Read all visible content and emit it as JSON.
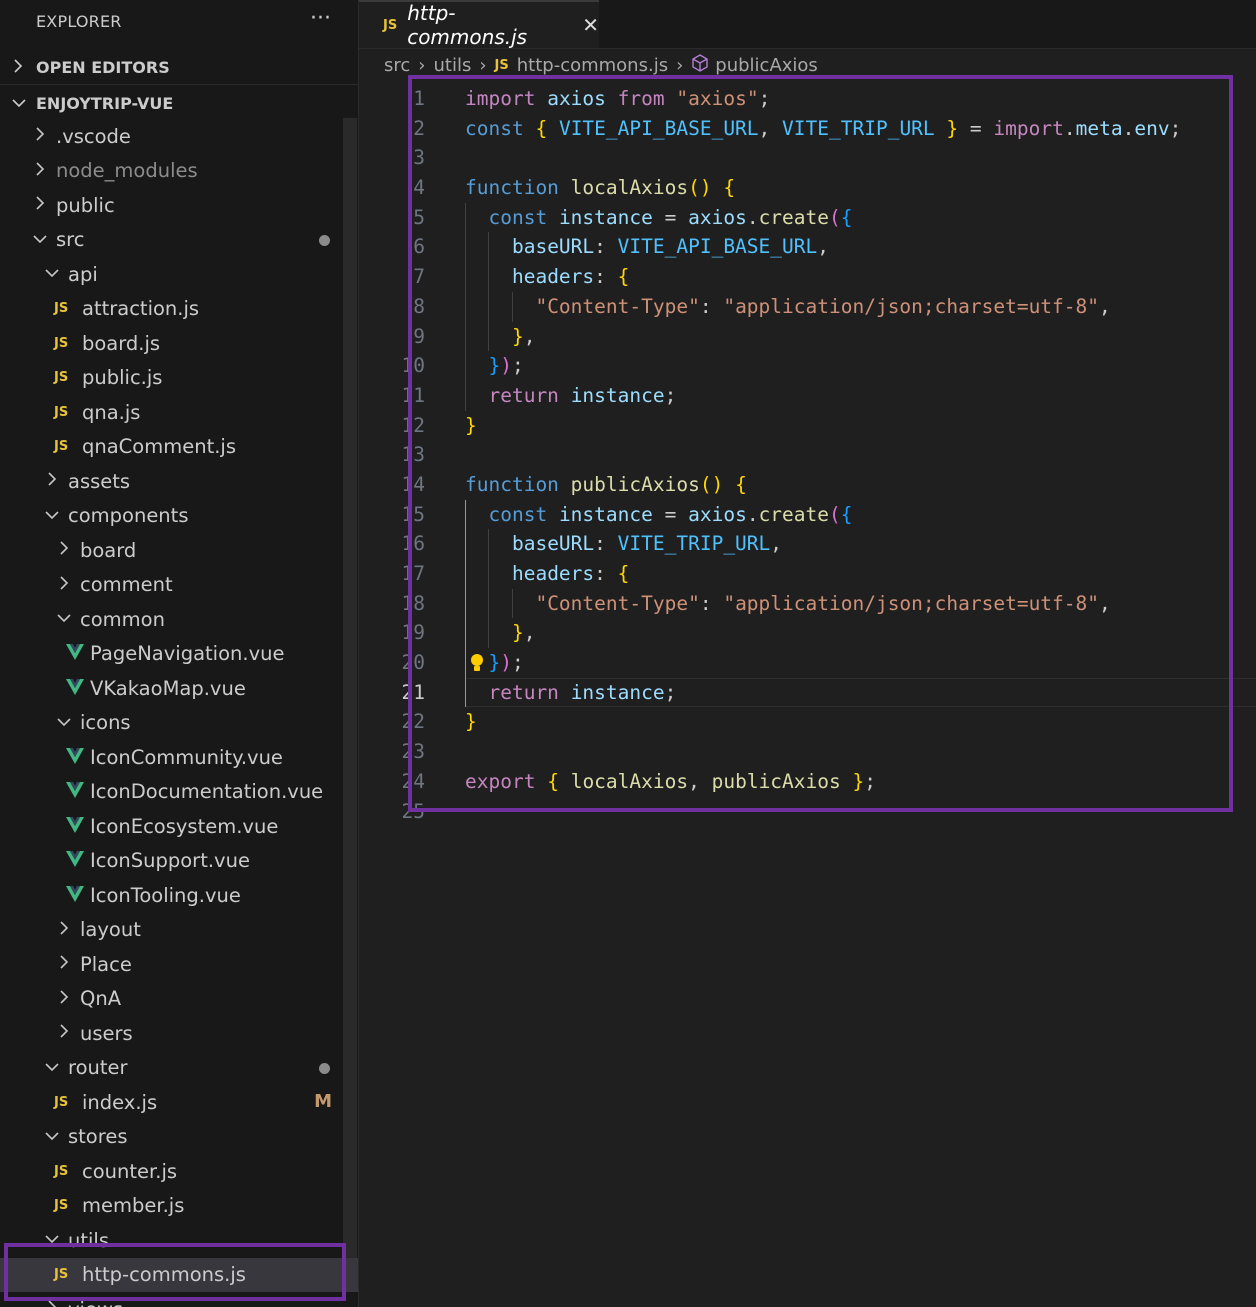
{
  "explorer": {
    "title": "EXPLORER",
    "more": "···",
    "open_editors": "OPEN EDITORS",
    "project": "ENJOYTRIP-VUE"
  },
  "tree": [
    {
      "label": ".vscode",
      "kind": "folder-closed",
      "depth": 0
    },
    {
      "label": "node_modules",
      "kind": "folder-closed",
      "depth": 0,
      "dim": true
    },
    {
      "label": "public",
      "kind": "folder-closed",
      "depth": 0
    },
    {
      "label": "src",
      "kind": "folder-open",
      "depth": 0,
      "dot": true
    },
    {
      "label": "api",
      "kind": "folder-open",
      "depth": 1
    },
    {
      "label": "attraction.js",
      "kind": "js",
      "depth": 2
    },
    {
      "label": "board.js",
      "kind": "js",
      "depth": 2
    },
    {
      "label": "public.js",
      "kind": "js",
      "depth": 2
    },
    {
      "label": "qna.js",
      "kind": "js",
      "depth": 2
    },
    {
      "label": "qnaComment.js",
      "kind": "js",
      "depth": 2
    },
    {
      "label": "assets",
      "kind": "folder-closed",
      "depth": 1
    },
    {
      "label": "components",
      "kind": "folder-open",
      "depth": 1
    },
    {
      "label": "board",
      "kind": "folder-closed",
      "depth": 2
    },
    {
      "label": "comment",
      "kind": "folder-closed",
      "depth": 2
    },
    {
      "label": "common",
      "kind": "folder-open",
      "depth": 2
    },
    {
      "label": "PageNavigation.vue",
      "kind": "vue",
      "depth": 3
    },
    {
      "label": "VKakaoMap.vue",
      "kind": "vue",
      "depth": 3
    },
    {
      "label": "icons",
      "kind": "folder-open",
      "depth": 2
    },
    {
      "label": "IconCommunity.vue",
      "kind": "vue",
      "depth": 3
    },
    {
      "label": "IconDocumentation.vue",
      "kind": "vue",
      "depth": 3
    },
    {
      "label": "IconEcosystem.vue",
      "kind": "vue",
      "depth": 3
    },
    {
      "label": "IconSupport.vue",
      "kind": "vue",
      "depth": 3
    },
    {
      "label": "IconTooling.vue",
      "kind": "vue",
      "depth": 3
    },
    {
      "label": "layout",
      "kind": "folder-closed",
      "depth": 2
    },
    {
      "label": "Place",
      "kind": "folder-closed",
      "depth": 2
    },
    {
      "label": "QnA",
      "kind": "folder-closed",
      "depth": 2
    },
    {
      "label": "users",
      "kind": "folder-closed",
      "depth": 2
    },
    {
      "label": "router",
      "kind": "folder-open",
      "depth": 1,
      "dot": true
    },
    {
      "label": "index.js",
      "kind": "js",
      "depth": 2,
      "badge": "M"
    },
    {
      "label": "stores",
      "kind": "folder-open",
      "depth": 1
    },
    {
      "label": "counter.js",
      "kind": "js",
      "depth": 2
    },
    {
      "label": "member.js",
      "kind": "js",
      "depth": 2
    },
    {
      "label": "utils",
      "kind": "folder-open",
      "depth": 1
    },
    {
      "label": "http-commons.js",
      "kind": "js",
      "depth": 2,
      "selected": true
    },
    {
      "label": "views",
      "kind": "folder-closed",
      "depth": 1
    }
  ],
  "editor": {
    "tab_label": "http-commons.js",
    "tab_icon": "JS",
    "breadcrumb": {
      "src": "src",
      "utils": "utils",
      "file": "http-commons.js",
      "symbol": "publicAxios"
    }
  },
  "code_lines": [
    "import axios from \"axios\";",
    "const { VITE_API_BASE_URL, VITE_TRIP_URL } = import.meta.env;",
    "",
    "function localAxios() {",
    "  const instance = axios.create({",
    "    baseURL: VITE_API_BASE_URL,",
    "    headers: {",
    "      \"Content-Type\": \"application/json;charset=utf-8\",",
    "    },",
    "  });",
    "  return instance;",
    "}",
    "",
    "function publicAxios() {",
    "  const instance = axios.create({",
    "    baseURL: VITE_TRIP_URL,",
    "    headers: {",
    "      \"Content-Type\": \"application/json;charset=utf-8\",",
    "    },",
    "  });",
    "  return instance;",
    "}",
    "",
    "export { localAxios, publicAxios };",
    ""
  ],
  "current_line": 21,
  "colors": {
    "highlight_box": "#7030a0",
    "keyword": "#c586c0",
    "storage": "#569cd6",
    "function": "#dcdcaa",
    "variable": "#9cdcfe",
    "constant": "#4fc1ff",
    "string": "#ce9178",
    "js_icon": "#e8c238",
    "vue_icon": "#41b883"
  }
}
